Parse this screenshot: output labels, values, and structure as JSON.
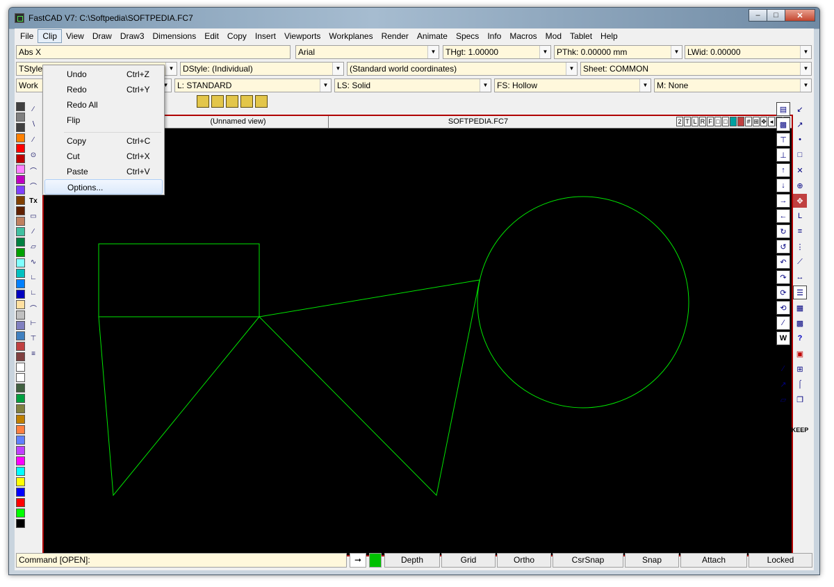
{
  "window": {
    "title": "FastCAD V7: C:\\Softpedia\\SOFTPEDIA.FC7",
    "controls": [
      "minimize",
      "maximize",
      "close"
    ]
  },
  "menubar": {
    "items": [
      "File",
      "Clip",
      "View",
      "Draw",
      "Draw3",
      "Dimensions",
      "Edit",
      "Copy",
      "Insert",
      "Viewports",
      "Workplanes",
      "Render",
      "Animate",
      "Specs",
      "Info",
      "Macros",
      "Mod",
      "Tablet",
      "Help"
    ],
    "active": "Clip"
  },
  "clip_menu": {
    "items": [
      {
        "label": "Undo",
        "shortcut": "Ctrl+Z"
      },
      {
        "label": "Redo",
        "shortcut": "Ctrl+Y"
      },
      {
        "label": "Redo All",
        "shortcut": ""
      },
      {
        "label": "Flip",
        "shortcut": ""
      },
      {
        "label": "Copy",
        "shortcut": "Ctrl+C"
      },
      {
        "label": "Cut",
        "shortcut": "Ctrl+X"
      },
      {
        "label": "Paste",
        "shortcut": "Ctrl+V"
      },
      {
        "label": "Options...",
        "shortcut": ""
      }
    ]
  },
  "toolbars": {
    "row1": {
      "abs": "Abs X",
      "font": "Arial",
      "thgt": "THgt: 1.00000",
      "pthk": "PThk: 0.00000 mm",
      "lwid": "LWid: 0.00000"
    },
    "row2": {
      "tstyle": "TStyle",
      "dstyle": "DStyle: (Individual)",
      "coords": "(Standard world coordinates)",
      "sheet": "Sheet: COMMON"
    },
    "row3": {
      "work": "Work",
      "layer": "L: STANDARD",
      "linestyle": "LS: Solid",
      "fillstyle": "FS: Hollow",
      "material": "M: None"
    }
  },
  "viewport": {
    "view_name": "(Unnamed view)",
    "file_name": "SOFTPEDIA.FC7",
    "header_buttons": [
      "2",
      "T",
      "L",
      "R",
      "F"
    ]
  },
  "palette": {
    "colors": [
      "#404040",
      "#808080",
      "#404040",
      "#ff8000",
      "#ff0000",
      "#c00000",
      "#ff80ff",
      "#c000c0",
      "#8040ff",
      "#804000",
      "#602000",
      "#c08060",
      "#40c0a0",
      "#008040",
      "#00a000",
      "#80ffff",
      "#00c0c0",
      "#0080ff",
      "#0000c0",
      "#ffe0a0",
      "#c0c0c0",
      "#8080c0",
      "#4080c0",
      "#c04040",
      "#804040",
      "#ffffff",
      "#ffffff",
      "#406040",
      "#00a040",
      "#808040",
      "#c08000",
      "#ff8040",
      "#6080ff",
      "#c040ff",
      "#ff00ff",
      "#00ffff",
      "#ffff00",
      "#0000ff",
      "#ff0000",
      "#00ff00",
      "#000000"
    ]
  },
  "leftbar": {
    "text_tool": "Tx"
  },
  "rightbar": {
    "keep_label": "KEEP",
    "help_label": "?",
    "w_label": "W"
  },
  "statusbar": {
    "command": "Command [OPEN]:",
    "buttons": [
      "Depth",
      "Grid",
      "Ortho",
      "CsrSnap",
      "Snap",
      "Attach",
      "Locked"
    ]
  },
  "colors": {
    "drawing": "#00e600",
    "canvas_bg": "#000000",
    "viewport_border": "#b00000",
    "field_bg": "#fff8dc"
  },
  "drawing": {
    "entities": [
      "rectangle",
      "triangle",
      "triangle",
      "circle",
      "line"
    ]
  }
}
